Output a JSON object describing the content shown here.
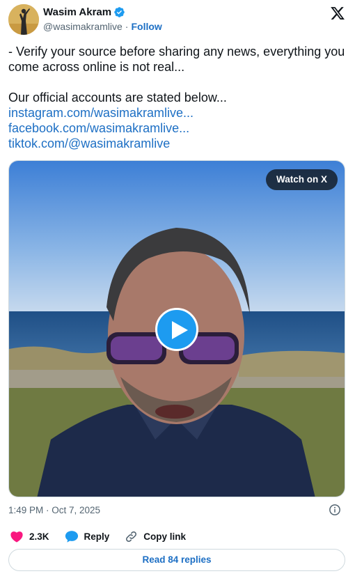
{
  "author": {
    "display_name": "Wasim Akram",
    "handle": "@wasimakramlive",
    "separator": "·",
    "follow_label": "Follow",
    "verified": true
  },
  "tweet": {
    "line1": "- Verify your source before sharing any news, everything you come across online is not real...",
    "line2": "Our official accounts are stated below...",
    "links": [
      "instagram.com/wasimakramlive...",
      "facebook.com/wasimakramlive...",
      "tiktok.com/@wasimakramlive"
    ]
  },
  "media": {
    "watch_label": "Watch on X"
  },
  "meta": {
    "timestamp": "1:49 PM · Oct 7, 2025"
  },
  "actions": {
    "likes": "2.3K",
    "reply_label": "Reply",
    "copy_label": "Copy link"
  },
  "footer": {
    "read_replies": "Read 84 replies"
  },
  "colors": {
    "link": "#1d6fc4",
    "secondary_text": "#536471",
    "like_pink": "#f91880",
    "play_blue": "#1d9bf0"
  }
}
